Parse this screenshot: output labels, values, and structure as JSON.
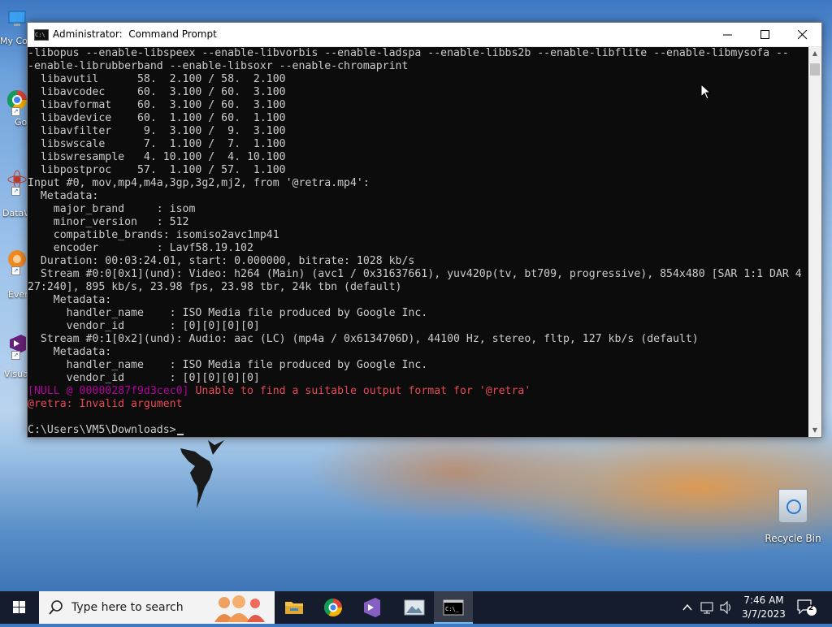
{
  "window": {
    "title": "Administrator:  Command Prompt",
    "lines": [
      {
        "text": "-libopus --enable-libspeex --enable-libvorbis --enable-ladspa --enable-libbs2b --enable-libflite --enable-libmysofa --",
        "cls": ""
      },
      {
        "text": "-enable-librubberband --enable-libsoxr --enable-chromaprint",
        "cls": ""
      },
      {
        "text": "  libavutil      58.  2.100 / 58.  2.100",
        "cls": ""
      },
      {
        "text": "  libavcodec     60.  3.100 / 60.  3.100",
        "cls": ""
      },
      {
        "text": "  libavformat    60.  3.100 / 60.  3.100",
        "cls": ""
      },
      {
        "text": "  libavdevice    60.  1.100 / 60.  1.100",
        "cls": ""
      },
      {
        "text": "  libavfilter     9.  3.100 /  9.  3.100",
        "cls": ""
      },
      {
        "text": "  libswscale      7.  1.100 /  7.  1.100",
        "cls": ""
      },
      {
        "text": "  libswresample   4. 10.100 /  4. 10.100",
        "cls": ""
      },
      {
        "text": "  libpostproc    57.  1.100 / 57.  1.100",
        "cls": ""
      },
      {
        "text": "Input #0, mov,mp4,m4a,3gp,3g2,mj2, from '@retra.mp4':",
        "cls": ""
      },
      {
        "text": "  Metadata:",
        "cls": ""
      },
      {
        "text": "    major_brand     : isom",
        "cls": ""
      },
      {
        "text": "    minor_version   : 512",
        "cls": ""
      },
      {
        "text": "    compatible_brands: isomiso2avc1mp41",
        "cls": ""
      },
      {
        "text": "    encoder         : Lavf58.19.102",
        "cls": ""
      },
      {
        "text": "  Duration: 00:03:24.01, start: 0.000000, bitrate: 1028 kb/s",
        "cls": ""
      },
      {
        "text": "  Stream #0:0[0x1](und): Video: h264 (Main) (avc1 / 0x31637661), yuv420p(tv, bt709, progressive), 854x480 [SAR 1:1 DAR 4",
        "cls": ""
      },
      {
        "text": "27:240], 895 kb/s, 23.98 fps, 23.98 tbr, 24k tbn (default)",
        "cls": ""
      },
      {
        "text": "    Metadata:",
        "cls": ""
      },
      {
        "text": "      handler_name    : ISO Media file produced by Google Inc.",
        "cls": ""
      },
      {
        "text": "      vendor_id       : [0][0][0][0]",
        "cls": ""
      },
      {
        "text": "  Stream #0:1[0x2](und): Audio: aac (LC) (mp4a / 0x6134706D), 44100 Hz, stereo, fltp, 127 kb/s (default)",
        "cls": ""
      },
      {
        "text": "    Metadata:",
        "cls": ""
      },
      {
        "text": "      handler_name    : ISO Media file produced by Google Inc.",
        "cls": ""
      },
      {
        "text": "      vendor_id       : [0][0][0][0]",
        "cls": ""
      },
      {
        "text": "",
        "cls": "",
        "parts": [
          {
            "text": "[NULL @ 00000287f9d3cec0]",
            "cls": "mag"
          },
          {
            "text": " Unable to find a suitable output format for '@retra'",
            "cls": "err"
          }
        ]
      },
      {
        "text": "@retra: Invalid argument",
        "cls": "err"
      },
      {
        "text": "",
        "cls": ""
      },
      {
        "text": "C:\\Users\\VM5\\Downloads>",
        "cls": "",
        "cursor": true
      }
    ]
  },
  "desktop": {
    "icons": [
      {
        "name": "this-pc",
        "label": "My Co"
      },
      {
        "name": "google-chrome",
        "label": "Go Ch"
      },
      {
        "name": "datawrapper",
        "label": "DataW"
      },
      {
        "name": "everything",
        "label": "Ever"
      },
      {
        "name": "visual-studio",
        "label": "Visua"
      }
    ],
    "recycle_bin": "Recycle Bin"
  },
  "taskbar": {
    "search_placeholder": "Type here to search",
    "time": "7:46 AM",
    "date": "3/7/2023",
    "notification_count": "2"
  },
  "colors": {
    "console_bg": "#0c0c0c",
    "console_fg": "#cccccc",
    "error": "#e74856",
    "magenta": "#b4009e"
  }
}
